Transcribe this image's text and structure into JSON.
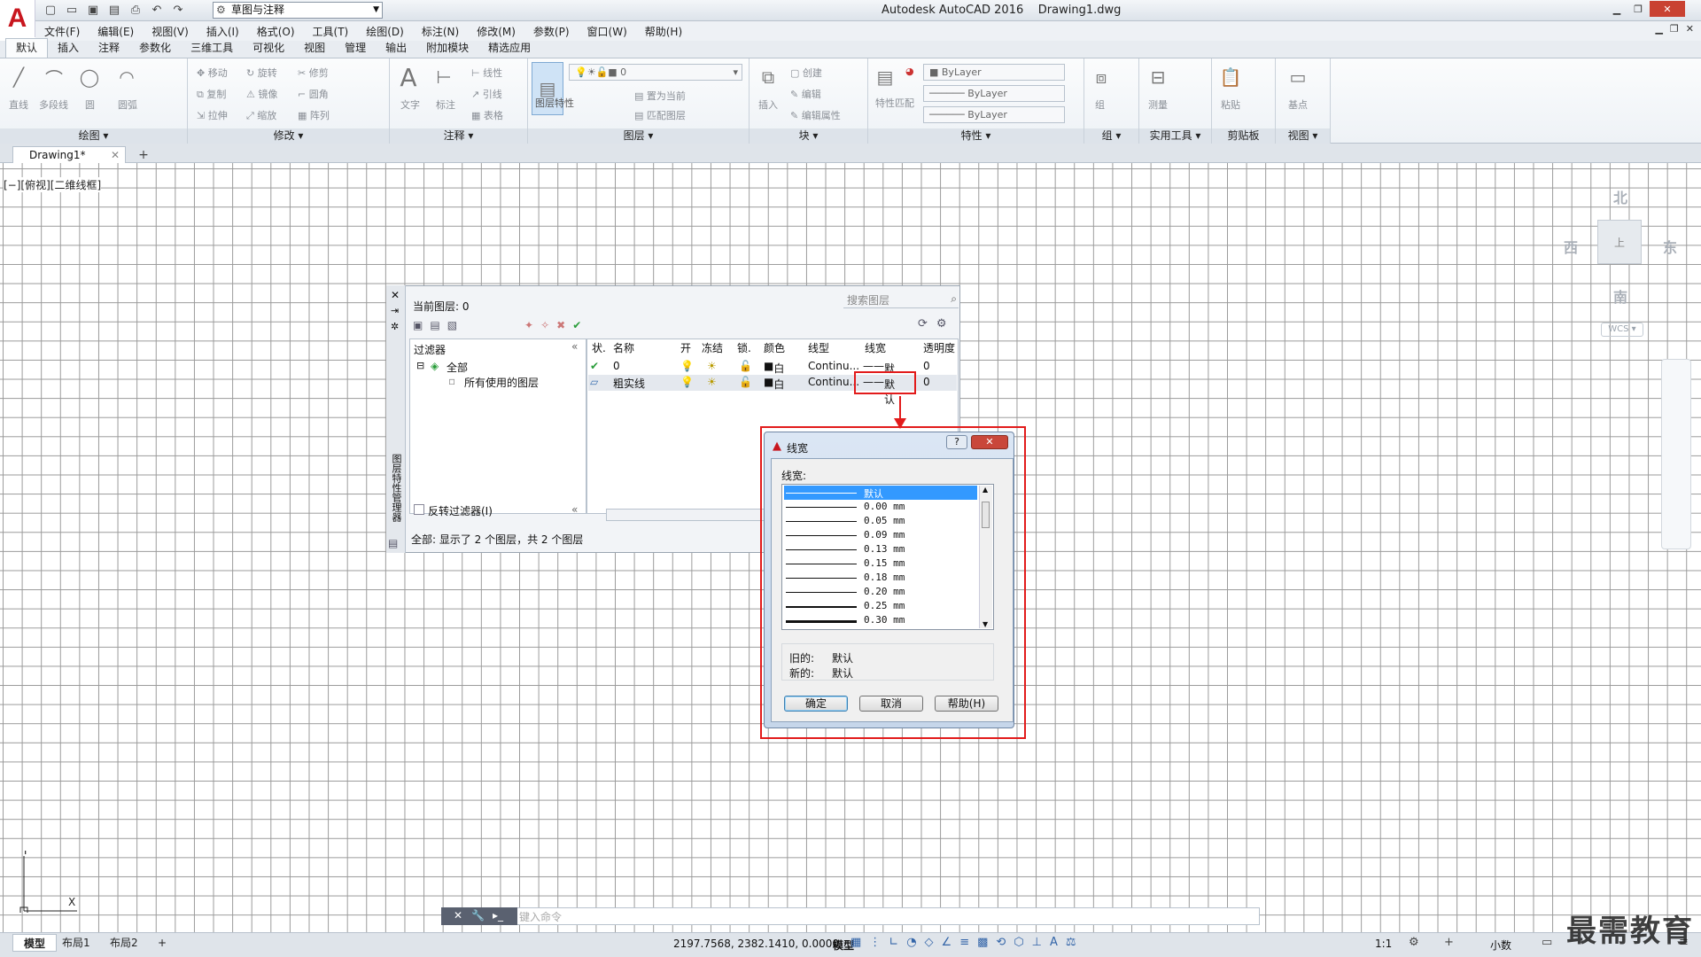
{
  "app": {
    "title": "Autodesk AutoCAD 2016",
    "file": "Drawing1.dwg",
    "workspace": "草图与注释"
  },
  "menu": [
    "文件(F)",
    "编辑(E)",
    "视图(V)",
    "插入(I)",
    "格式(O)",
    "工具(T)",
    "绘图(D)",
    "标注(N)",
    "修改(M)",
    "参数(P)",
    "窗口(W)",
    "帮助(H)"
  ],
  "ribbon_tabs": [
    "默认",
    "插入",
    "注释",
    "参数化",
    "三维工具",
    "可视化",
    "视图",
    "管理",
    "输出",
    "附加模块",
    "精选应用"
  ],
  "ribbon": {
    "draw": {
      "title": "绘图",
      "items": [
        "直线",
        "多段线",
        "圆",
        "圆弧"
      ]
    },
    "modify": {
      "title": "修改",
      "items": [
        "移动",
        "旋转",
        "修剪",
        "复制",
        "镜像",
        "圆角",
        "拉伸",
        "缩放",
        "阵列"
      ]
    },
    "annotation": {
      "title": "注释",
      "items": [
        "文字",
        "标注",
        "线性",
        "引线",
        "表格"
      ]
    },
    "layers": {
      "title": "图层",
      "layer_props": "图层特性",
      "current": "0",
      "make_current": "置为当前",
      "match": "匹配图层"
    },
    "block": {
      "title": "块",
      "insert": "插入",
      "create": "创建",
      "edit": "编辑",
      "edit_attr": "编辑属性"
    },
    "properties": {
      "title": "特性",
      "match_props": "特性匹配",
      "color": "ByLayer",
      "linetype": "ByLayer",
      "lineweight": "ByLayer"
    },
    "groups": {
      "title": "组",
      "group": "组"
    },
    "utilities": {
      "title": "实用工具",
      "measure": "测量"
    },
    "clipboard": {
      "title": "剪贴板",
      "paste": "粘贴"
    },
    "view": {
      "title": "视图",
      "base": "基点"
    }
  },
  "doc_tab": "Drawing1*",
  "viewport_label": "[−][俯视][二维线框]",
  "viewcube": {
    "north": "北",
    "south": "南",
    "east": "东",
    "west": "西",
    "top": "上",
    "wcs": "WCS"
  },
  "layer_palette": {
    "current_layer": "当前图层: 0",
    "search_placeholder": "搜索图层",
    "filters_header": "过滤器",
    "filter_all": "全部",
    "filter_used": "所有使用的图层",
    "invert_filter": "反转过滤器(I)",
    "side_title": "图层特性管理器",
    "columns": [
      "状.",
      "名称",
      "开",
      "冻结",
      "锁.",
      "颜色",
      "线型",
      "线宽",
      "透明度"
    ],
    "rows": [
      {
        "status": "✔",
        "name": "0",
        "color": "白",
        "linetype": "Continu...",
        "lineweight": "默认",
        "transparency": "0"
      },
      {
        "status": "▱",
        "name": "粗实线",
        "color": "白",
        "linetype": "Continu...",
        "lineweight": "默认",
        "transparency": "0"
      }
    ],
    "status": "全部: 显示了 2 个图层，共 2 个图层"
  },
  "lineweight_dialog": {
    "title": "线宽",
    "list_label": "线宽:",
    "items": [
      {
        "label": "默认",
        "thickness": 1,
        "selected": true
      },
      {
        "label": "0.00 mm",
        "thickness": 1
      },
      {
        "label": "0.05 mm",
        "thickness": 1
      },
      {
        "label": "0.09 mm",
        "thickness": 1
      },
      {
        "label": "0.13 mm",
        "thickness": 1
      },
      {
        "label": "0.15 mm",
        "thickness": 1
      },
      {
        "label": "0.18 mm",
        "thickness": 1
      },
      {
        "label": "0.20 mm",
        "thickness": 1
      },
      {
        "label": "0.25 mm",
        "thickness": 2
      },
      {
        "label": "0.30 mm",
        "thickness": 3
      }
    ],
    "old_label": "旧的:",
    "old_value": "默认",
    "new_label": "新的:",
    "new_value": "默认",
    "ok": "确定",
    "cancel": "取消",
    "help": "帮助(H)"
  },
  "command_line": {
    "placeholder": "键入命令"
  },
  "layout_tabs": [
    "模型",
    "布局1",
    "布局2"
  ],
  "status_bar": {
    "coords": "2197.7568, 2382.1410, 0.0000",
    "model": "模型",
    "scale": "1:1",
    "units": "小数"
  },
  "watermark": "最需教育",
  "colors": {
    "accent": "#3399ff",
    "highlight": "#e21b1b",
    "logo": "#c8161e"
  }
}
